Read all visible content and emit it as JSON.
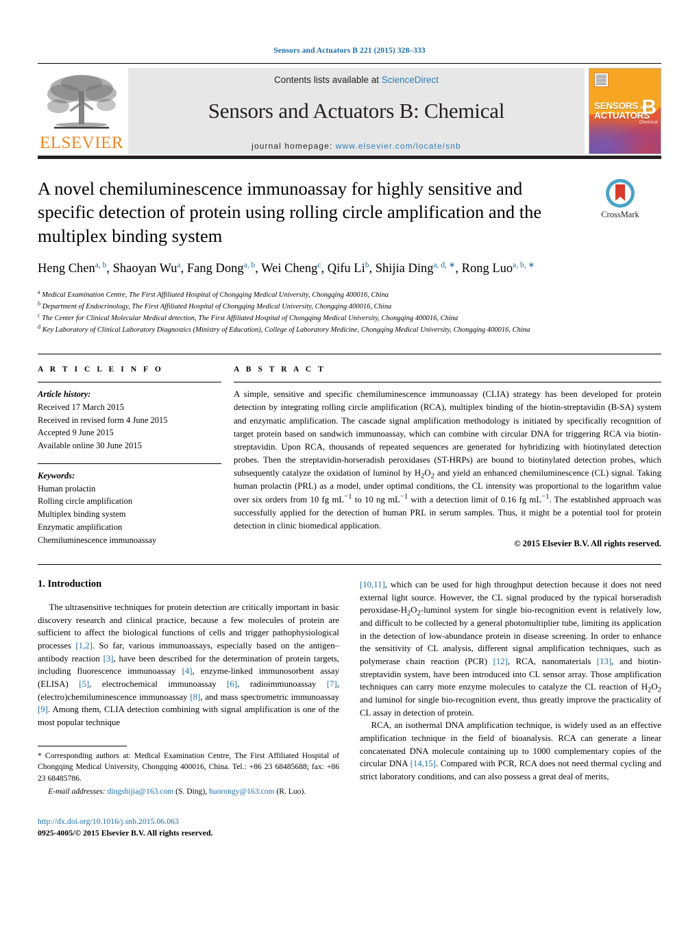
{
  "running_head": "Sensors and Actuators B 221 (2015) 328–333",
  "masthead": {
    "contents_prefix": "Contents lists available at ",
    "contents_link": "ScienceDirect",
    "journal_title": "Sensors and Actuators B: Chemical",
    "homepage_label": "journal homepage:",
    "homepage_url": "www.elsevier.com/locate/snb",
    "publisher_logo_text": "ELSEVIER",
    "cover": {
      "line1": "SENSORS",
      "and": "and",
      "line2": "ACTUATORS",
      "volume_letter": "B",
      "sub_label": "Chemical"
    }
  },
  "crossmark": {
    "label": "CrossMark"
  },
  "article": {
    "title": "A novel chemiluminescence immunoassay for highly sensitive and specific detection of protein using rolling circle amplification and the multiplex binding system",
    "authors": [
      {
        "name": "Heng Chen",
        "sup": "a, b",
        "sep": ", "
      },
      {
        "name": "Shaoyan Wu",
        "sup": "a",
        "sep": ", "
      },
      {
        "name": "Fang Dong",
        "sup": "a, b",
        "sep": ", "
      },
      {
        "name": "Wei Cheng",
        "sup": "c",
        "sep": ", "
      },
      {
        "name": "Qifu Li",
        "sup": "b",
        "sep": ", "
      },
      {
        "name": "Shijia Ding",
        "sup": "a, d, ∗",
        "sep": ", "
      },
      {
        "name": "Rong Luo",
        "sup": "a, b, ∗",
        "sep": ""
      }
    ],
    "affiliations": [
      {
        "mark": "a",
        "text": "Medical Examination Centre, The First Affiliated Hospital of Chongqing Medical University, Chongqing 400016, China"
      },
      {
        "mark": "b",
        "text": "Department of Endocrinology, The First Affiliated Hospital of Chongqing Medical University, Chongqing 400016, China"
      },
      {
        "mark": "c",
        "text": "The Center for Clinical Molecular Medical detection, The First Affiliated Hospital of Chongqing Medical University, Chongqing 400016, China"
      },
      {
        "mark": "d",
        "text": "Key Laboratory of Clinical Laboratory Diagnostics (Ministry of Education), College of Laboratory Medicine, Chongqing Medical University, Chongqing 400016, China"
      }
    ]
  },
  "article_info": {
    "heading": "A R T I C L E   I N F O",
    "history_label": "Article history:",
    "history": [
      "Received 17 March 2015",
      "Received in revised form 4 June 2015",
      "Accepted 9 June 2015",
      "Available online 30 June 2015"
    ],
    "keywords_label": "Keywords:",
    "keywords": [
      "Human prolactin",
      "Rolling circle amplification",
      "Multiplex binding system",
      "Enzymatic amplification",
      "Chemiluminescence immunoassay"
    ]
  },
  "abstract": {
    "heading": "A B S T R A C T",
    "text_part1": "A simple, sensitive and specific chemiluminescence immunoassay (CLIA) strategy has been developed for protein detection by integrating rolling circle amplification (RCA), multiplex binding of the biotin-streptavidin (B-SA) system and enzymatic amplification. The cascade signal amplification methodology is initiated by specifically recognition of target protein based on sandwich immunoassay, which can combine with circular DNA for triggering RCA via biotin-streptavidin. Upon RCA, thousands of repeated sequences are generated for hybridizing with biotinylated detection probes. Then the streptavidin-horseradish peroxidases (ST-HRPs) are bound to biotinylated detection probes, which subsequently catalyze the oxidation of luminol by H",
    "h2o2_sub1": "2",
    "h2o2_mid": "O",
    "h2o2_sub2": "2",
    "text_part2": " and yield an enhanced chemiluminescence (CL) signal. Taking human prolactin (PRL) as a model, under optimal conditions, the CL intensity was proportional to the logarithm value over six orders from 10 fg mL",
    "exp1": "−1",
    "text_part3": " to 10 ng mL",
    "exp2": "−1",
    "text_part4": " with a detection limit of 0.16 fg mL",
    "exp3": "−1",
    "text_part5": ". The established approach was successfully applied for the detection of human PRL in serum samples. Thus, it might be a potential tool for protein detection in clinic biomedical application.",
    "copyright": "© 2015 Elsevier B.V. All rights reserved."
  },
  "introduction": {
    "heading": "1.  Introduction",
    "left_p1_a": "The ultrasensitive techniques for protein detection are critically important in basic discovery research and clinical practice, because a few molecules of protein are sufficient to affect the biological functions of cells and trigger pathophysiological processes ",
    "ref_1_2": "[1,2]",
    "left_p1_b": ". So far, various immunoassays, especially based on the antigen–antibody reaction ",
    "ref_3": "[3]",
    "left_p1_c": ", have been described for the determination of protein targets, including fluorescence immunoassay ",
    "ref_4": "[4]",
    "left_p1_d": ", enzyme-linked immunosorbent assay (ELISA) ",
    "ref_5": "[5]",
    "left_p1_e": ", electrochemical immunoassay ",
    "ref_6": "[6]",
    "left_p1_f": ", radioimmunoassay ",
    "ref_7": "[7]",
    "left_p1_g": ", (electro)chemiluminescence immunoassay ",
    "ref_8": "[8]",
    "left_p1_h": ", and mass spectrometric immunoassay ",
    "ref_9": "[9]",
    "left_p1_i": ". Among them, CLIA detection combining with signal amplification is one of the most popular technique ",
    "ref_10_11": "[10,11]",
    "right_p1_a": ", which can be used for high throughput detection because it does not need external light source. However, the CL signal produced by the typical horseradish peroxidase-H",
    "sub_2a": "2",
    "right_o": "O",
    "sub_2b": "2",
    "right_p1_b": "-luminol system for single bio-recognition event is relatively low, and difficult to be collected by a general photomultiplier tube, limiting its application in the detection of low-abundance protein in disease screening. In order to enhance the sensitivity of CL analysis, different signal amplification techniques, such as polymerase chain reaction (PCR) ",
    "ref_12": "[12]",
    "right_p1_c": ", RCA, nanomaterials ",
    "ref_13": "[13]",
    "right_p1_d": ", and biotin-streptavidin system, have been introduced into CL sensor array. Those amplification techniques can carry more enzyme molecules to catalyze the CL reaction of H",
    "sub_2c": "2",
    "right_o2": "O",
    "sub_2d": "2",
    "right_p1_e": " and luminol for single bio-recognition event, thus greatly improve the practicality of CL assay in detection of protein.",
    "right_p2_a": "RCA, an isothermal DNA amplification technique, is widely used as an effective amplification technique in the field of bioanalysis. RCA can generate a linear concatenated DNA molecule containing up to 1000 complementary copies of the circular DNA ",
    "ref_14_15": "[14,15]",
    "right_p2_b": ". Compared with PCR, RCA does not need thermal cycling and strict laboratory conditions, and can also possess a great deal of merits,"
  },
  "footnotes": {
    "corresponding": "*  Corresponding authors at: Medical Examination Centre, The First Affiliated Hospital of Chongqing Medical University, Chongqing 400016, China. Tel.: +86 23 68485688; fax: +86 23 68485786.",
    "email_label": "E-mail addresses:",
    "email_1": "dingshijia@163.com",
    "email_1_owner": " (S. Ding), ",
    "email_2": "huorongy@163.com",
    "email_2_owner": " (R. Luo).",
    "doi": "http://dx.doi.org/10.1016/j.snb.2015.06.063",
    "issn": "0925-4005/© 2015 Elsevier B.V. All rights reserved."
  },
  "colors": {
    "link_blue": "#1b6ca8",
    "elsevier_orange": "#f08522",
    "band_grey": "#e7e7e8"
  }
}
